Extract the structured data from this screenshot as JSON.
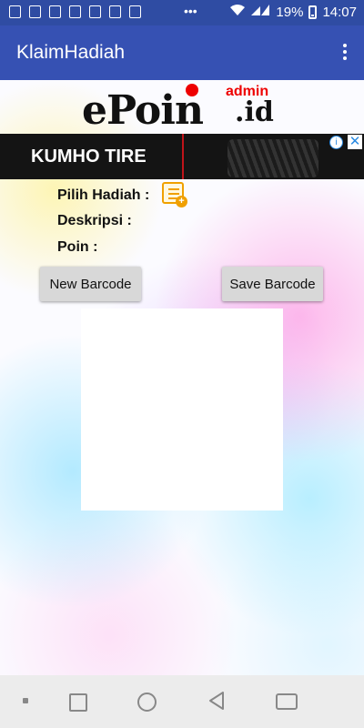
{
  "status_bar": {
    "notification_icons": [
      "notif-icon",
      "notif-icon",
      "notif-icon",
      "notif-icon",
      "notif-icon",
      "notif-icon",
      "notif-icon"
    ],
    "more": "•••",
    "battery": "19%",
    "time": "14:07"
  },
  "app_bar": {
    "title": "KlaimHadiah"
  },
  "logo": {
    "main": "ePoin",
    "admin": "admin",
    "domain": ".id"
  },
  "ad": {
    "text": "KUMHO TIRE",
    "info": "i",
    "close": "✕"
  },
  "form": {
    "pilih_hadiah_label": "Pilih Hadiah :",
    "deskripsi_label": "Deskripsi :",
    "poin_label": "Poin :"
  },
  "buttons": {
    "new_barcode": "New Barcode",
    "save_barcode": "Save Barcode"
  },
  "colors": {
    "status_bar": "#2f4ca3",
    "app_bar": "#3651b3",
    "accent_icon": "#f0a000"
  }
}
